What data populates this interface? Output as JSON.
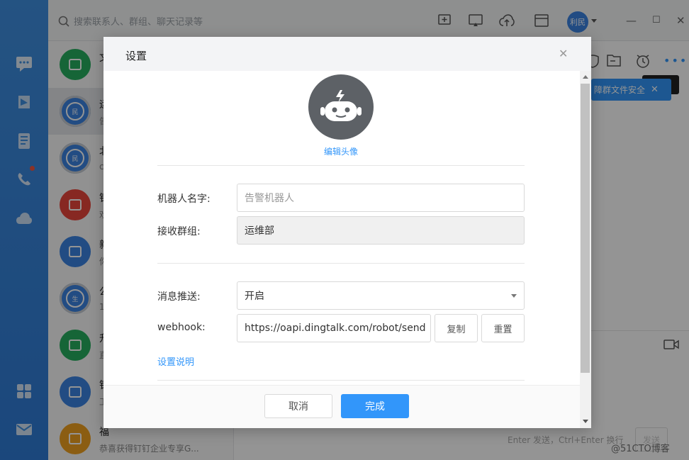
{
  "search": {
    "placeholder": "搜索联系人、群组、聊天记录等"
  },
  "user": {
    "avatar_text": "利民"
  },
  "conversations": [
    {
      "title": "文",
      "subtitle": "",
      "color": "#27ae60",
      "icon": "file-transfer-icon"
    },
    {
      "title": "运",
      "subtitle": "告",
      "color": "#3b84e2",
      "icon": "group-avatar",
      "badge": "民"
    },
    {
      "title": "北",
      "subtitle": "c",
      "color": "#3b84e2",
      "icon": "group-avatar",
      "badge": "民"
    },
    {
      "title": "钉",
      "subtitle": "欢",
      "color": "#e8453c",
      "icon": "mail-icon"
    },
    {
      "title": "新",
      "subtitle": "你",
      "color": "#3b84e2",
      "icon": "add-friend-icon"
    },
    {
      "title": "公",
      "subtitle": "1",
      "color": "#3b84e2",
      "icon": "group-photo",
      "badge": "生"
    },
    {
      "title": "升",
      "subtitle": "直",
      "color": "#27ae60",
      "icon": "upgrade-icon"
    },
    {
      "title": "钉",
      "subtitle": "工",
      "color": "#3b84e2",
      "icon": "person-photo"
    },
    {
      "title": "福",
      "subtitle": "恭喜获得钉钉企业专享G...",
      "color": "#f0a020",
      "icon": "gift-icon"
    }
  ],
  "banner": {
    "text": "障群文件安全"
  },
  "chat": {
    "footer_hint": "Enter 发送，Ctrl+Enter 换行",
    "send_label": "发送"
  },
  "dialog": {
    "title": "设置",
    "edit_avatar": "编辑头像",
    "robot_name_label": "机器人名字:",
    "robot_name_placeholder": "告警机器人",
    "group_label": "接收群组:",
    "group_value": "运维部",
    "push_label": "消息推送:",
    "push_value": "开启",
    "webhook_label": "webhook:",
    "webhook_value": "https://oapi.dingtalk.com/robot/send",
    "copy_label": "复制",
    "reset_label": "重置",
    "help_link": "设置说明",
    "cancel_label": "取消",
    "ok_label": "完成"
  },
  "watermark": "@51CTO博客",
  "colors": {
    "accent": "#3296fa",
    "rail": "#3f8fe0",
    "danger": "#f25643"
  }
}
